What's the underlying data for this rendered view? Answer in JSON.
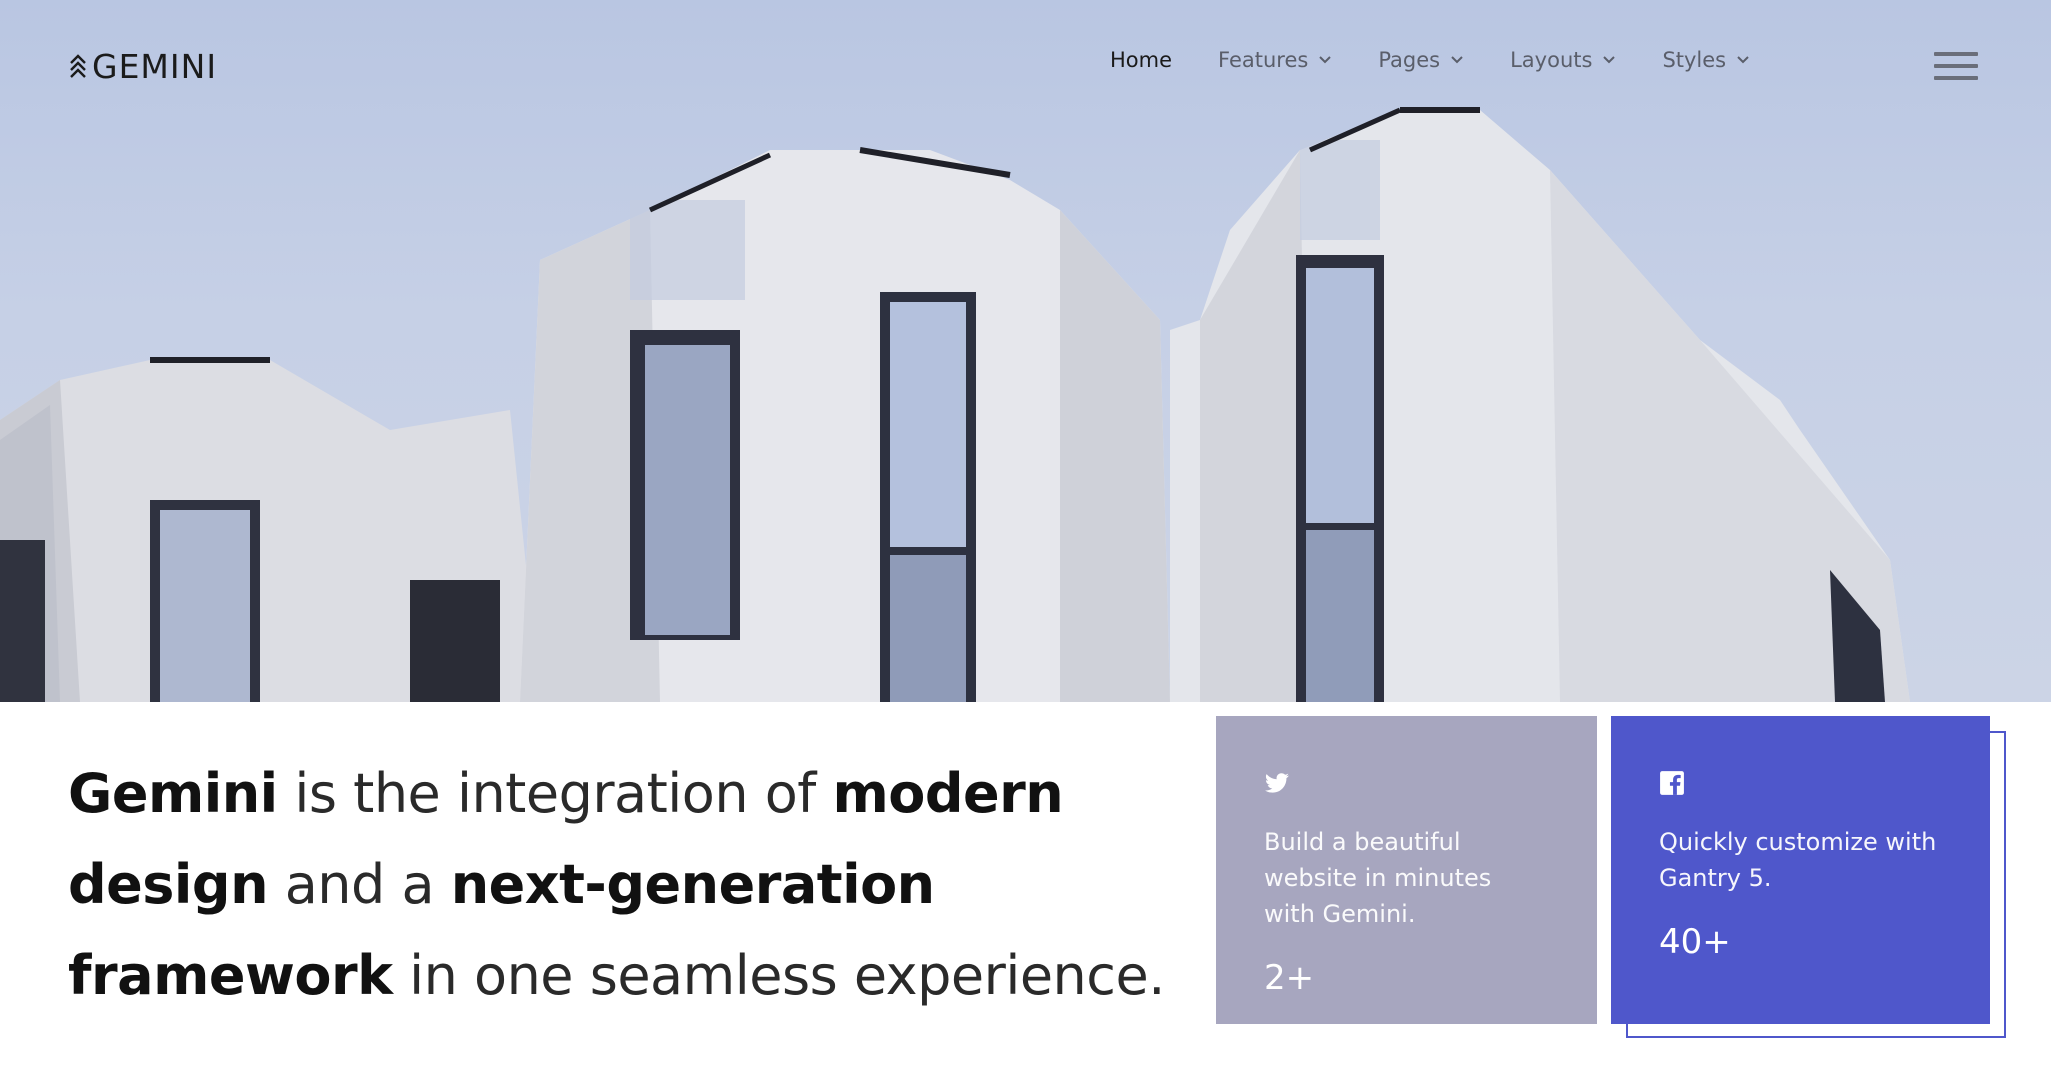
{
  "header": {
    "logo_text": "GEMINI",
    "nav": [
      {
        "label": "Home",
        "active": true,
        "has_dropdown": false
      },
      {
        "label": "Features",
        "active": false,
        "has_dropdown": true
      },
      {
        "label": "Pages",
        "active": false,
        "has_dropdown": true
      },
      {
        "label": "Layouts",
        "active": false,
        "has_dropdown": true
      },
      {
        "label": "Styles",
        "active": false,
        "has_dropdown": true
      }
    ],
    "menu_icon": "hamburger-menu-icon"
  },
  "hero": {
    "image": "white-concrete-building-against-sky"
  },
  "headline": {
    "parts": [
      {
        "text": "Gemini",
        "bold": true
      },
      {
        "text": " is the integration of ",
        "bold": false
      },
      {
        "text": "modern design",
        "bold": true
      },
      {
        "text": " and a ",
        "bold": false
      },
      {
        "text": "next-generation framework",
        "bold": true
      },
      {
        "text": " in one seamless experience.",
        "bold": false
      }
    ]
  },
  "cards": [
    {
      "icon": "twitter-icon",
      "text": "Build a beautiful website in minutes with Gemini.",
      "count": "2+",
      "color": "#a7a6bf"
    },
    {
      "icon": "facebook-icon",
      "text": "Quickly customize with Gantry 5.",
      "count": "40+",
      "color": "#4f57cb"
    }
  ]
}
